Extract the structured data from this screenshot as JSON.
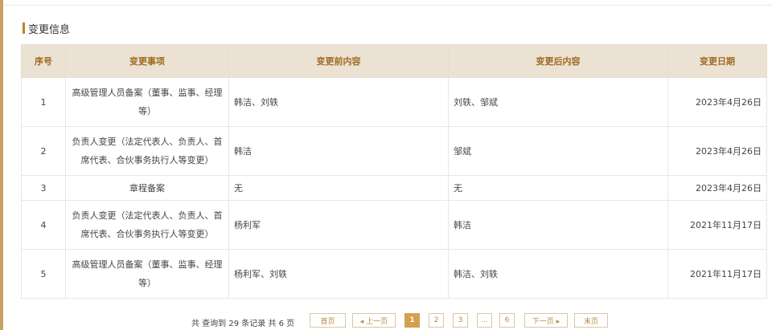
{
  "section": {
    "title": "变更信息"
  },
  "table": {
    "headers": [
      "序号",
      "变更事项",
      "变更前内容",
      "变更后内容",
      "变更日期"
    ],
    "rows": [
      {
        "index": "1",
        "item": "高级管理人员备案（董事、监事、经理等）",
        "before": "韩洁、刘轶",
        "after": "刘轶、邹斌",
        "date": "2023年4月26日"
      },
      {
        "index": "2",
        "item": "负责人变更（法定代表人、负责人、首席代表、合伙事务执行人等变更）",
        "before": "韩洁",
        "after": "邹斌",
        "date": "2023年4月26日"
      },
      {
        "index": "3",
        "item": "章程备案",
        "before": "无",
        "after": "无",
        "date": "2023年4月26日"
      },
      {
        "index": "4",
        "item": "负责人变更（法定代表人、负责人、首席代表、合伙事务执行人等变更）",
        "before": "杨利军",
        "after": "韩洁",
        "date": "2021年11月17日"
      },
      {
        "index": "5",
        "item": "高级管理人员备案（董事、监事、经理等）",
        "before": "杨利军、刘轶",
        "after": "韩洁、刘轶",
        "date": "2021年11月17日"
      }
    ]
  },
  "pagination": {
    "info": "共 查询到 29 条记录 共 6 页",
    "first": "首页",
    "prev": "◂ 上一页",
    "pages": [
      "1",
      "2",
      "3",
      "...",
      "6"
    ],
    "current": "1",
    "next": "下一页 ▸",
    "last": "末页"
  },
  "colors": {
    "accent": "#c9a261",
    "header_bg": "#ebe2d4",
    "header_text": "#a06b1f",
    "active_page": "#d6a050"
  }
}
